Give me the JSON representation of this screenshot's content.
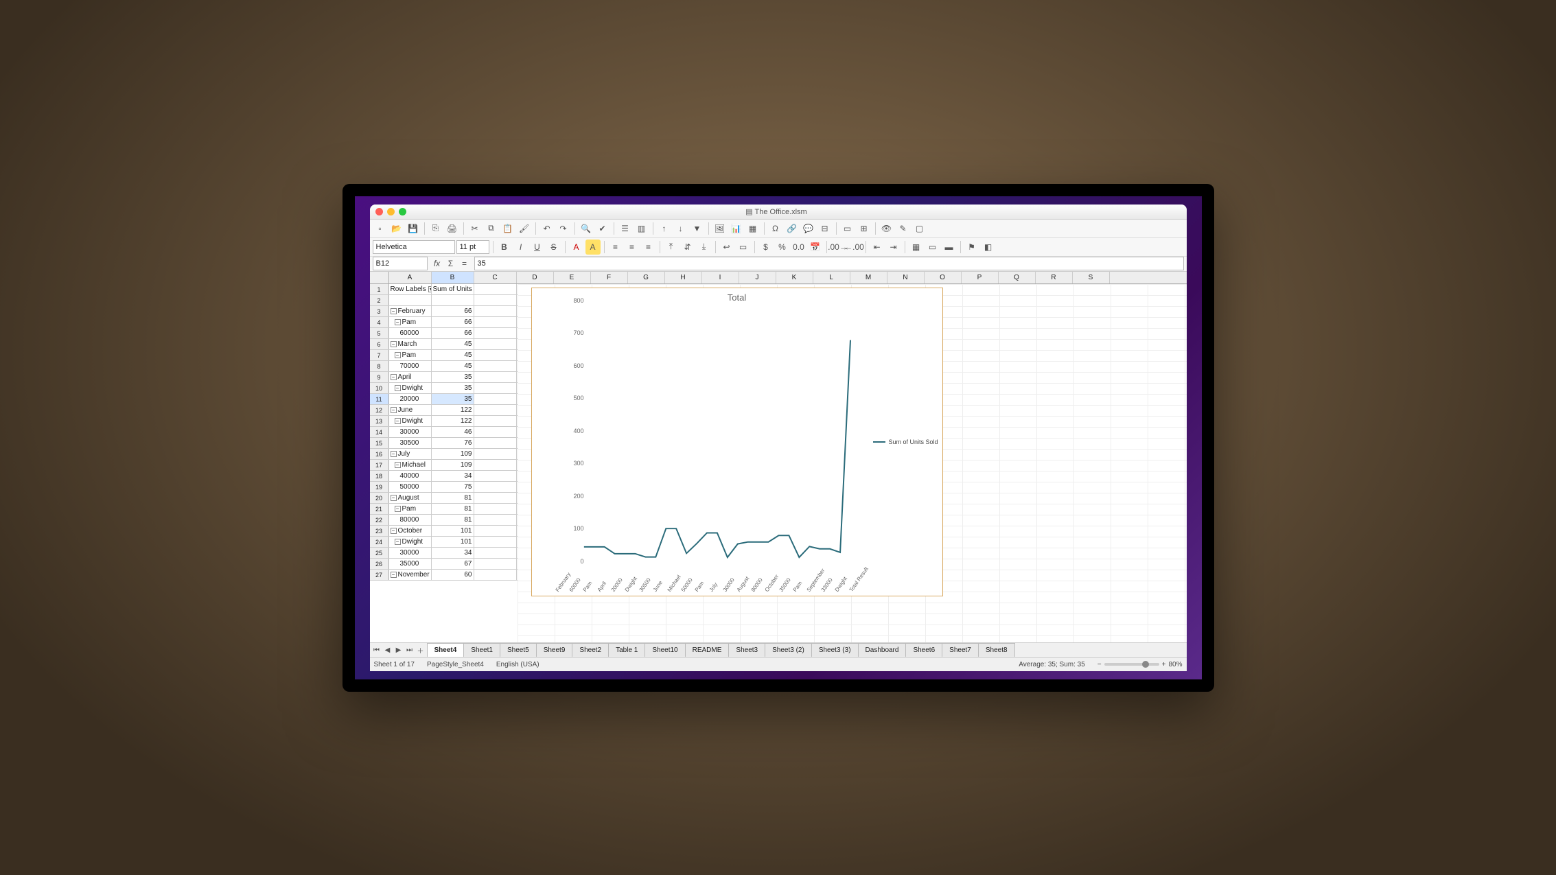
{
  "window": {
    "title": "The Office.xlsm"
  },
  "toolbar": {
    "font_name": "Helvetica",
    "font_size": "11 pt"
  },
  "formula": {
    "name_box": "B12",
    "value": "35"
  },
  "columns": [
    "A",
    "B",
    "C",
    "D",
    "E",
    "F",
    "G",
    "H",
    "I",
    "J",
    "K",
    "L",
    "M",
    "N",
    "O",
    "P",
    "Q",
    "R",
    "S"
  ],
  "grid": {
    "header_row": 1,
    "header_a": "Row Labels",
    "header_b": "Sum of Units Sold",
    "rows": [
      {
        "n": 2,
        "a": "",
        "b": ""
      },
      {
        "n": 3,
        "a": "February",
        "b": "66",
        "grp": 1
      },
      {
        "n": 4,
        "a": "Pam",
        "b": "66",
        "grp": 2
      },
      {
        "n": 5,
        "a": "60000",
        "b": "66",
        "grp": 3
      },
      {
        "n": 6,
        "a": "March",
        "b": "45",
        "grp": 1
      },
      {
        "n": 7,
        "a": "Pam",
        "b": "45",
        "grp": 2
      },
      {
        "n": 8,
        "a": "70000",
        "b": "45",
        "grp": 3
      },
      {
        "n": 9,
        "a": "April",
        "b": "35",
        "grp": 1
      },
      {
        "n": 10,
        "a": "Dwight",
        "b": "35",
        "grp": 2
      },
      {
        "n": 11,
        "a": "20000",
        "b": "35",
        "grp": 3,
        "sel": true
      },
      {
        "n": 12,
        "a": "June",
        "b": "122",
        "grp": 1
      },
      {
        "n": 13,
        "a": "Dwight",
        "b": "122",
        "grp": 2
      },
      {
        "n": 14,
        "a": "30000",
        "b": "46",
        "grp": 3
      },
      {
        "n": 15,
        "a": "30500",
        "b": "76",
        "grp": 3
      },
      {
        "n": 16,
        "a": "July",
        "b": "109",
        "grp": 1
      },
      {
        "n": 17,
        "a": "Michael",
        "b": "109",
        "grp": 2
      },
      {
        "n": 18,
        "a": "40000",
        "b": "34",
        "grp": 3
      },
      {
        "n": 19,
        "a": "50000",
        "b": "75",
        "grp": 3
      },
      {
        "n": 20,
        "a": "August",
        "b": "81",
        "grp": 1
      },
      {
        "n": 21,
        "a": "Pam",
        "b": "81",
        "grp": 2
      },
      {
        "n": 22,
        "a": "80000",
        "b": "81",
        "grp": 3
      },
      {
        "n": 23,
        "a": "October",
        "b": "101",
        "grp": 1
      },
      {
        "n": 24,
        "a": "Dwight",
        "b": "101",
        "grp": 2
      },
      {
        "n": 25,
        "a": "30000",
        "b": "34",
        "grp": 3
      },
      {
        "n": 26,
        "a": "35000",
        "b": "67",
        "grp": 3
      },
      {
        "n": 27,
        "a": "November",
        "b": "60",
        "grp": 1
      }
    ]
  },
  "tabs": [
    "Sheet4",
    "Sheet1",
    "Sheet5",
    "Sheet9",
    "Sheet2",
    "Table 1",
    "Sheet10",
    "README",
    "Sheet3",
    "Sheet3 (2)",
    "Sheet3 (3)",
    "Dashboard",
    "Sheet6",
    "Sheet7",
    "Sheet8"
  ],
  "active_tab": "Sheet4",
  "status": {
    "sheet": "Sheet 1 of 17",
    "pagestyle": "PageStyle_Sheet4",
    "lang": "English (USA)",
    "summary": "Average: 35; Sum: 35",
    "zoom": "80%"
  },
  "chart_data": {
    "type": "line",
    "title": "Total",
    "ylabel": "",
    "xlabel": "",
    "ylim": [
      0,
      800
    ],
    "yticks": [
      0,
      100,
      200,
      300,
      400,
      500,
      600,
      700,
      800
    ],
    "legend": "Sum of Units Sold",
    "categories": [
      "February",
      "60000",
      "Pam",
      "April",
      "20000",
      "Dwight",
      "30500",
      "June",
      "Michael",
      "50000",
      "Pam",
      "July",
      "30000",
      "August",
      "80000",
      "October",
      "35000",
      "Pam",
      "September",
      "33000",
      "Dwight",
      "Total Result"
    ],
    "series": [
      {
        "name": "Sum of Units Sold",
        "values": [
          66,
          66,
          66,
          45,
          45,
          45,
          35,
          35,
          122,
          122,
          46,
          76,
          109,
          109,
          34,
          75,
          81,
          81,
          81,
          101,
          101,
          34,
          67,
          60,
          60,
          49,
          700
        ]
      }
    ]
  }
}
